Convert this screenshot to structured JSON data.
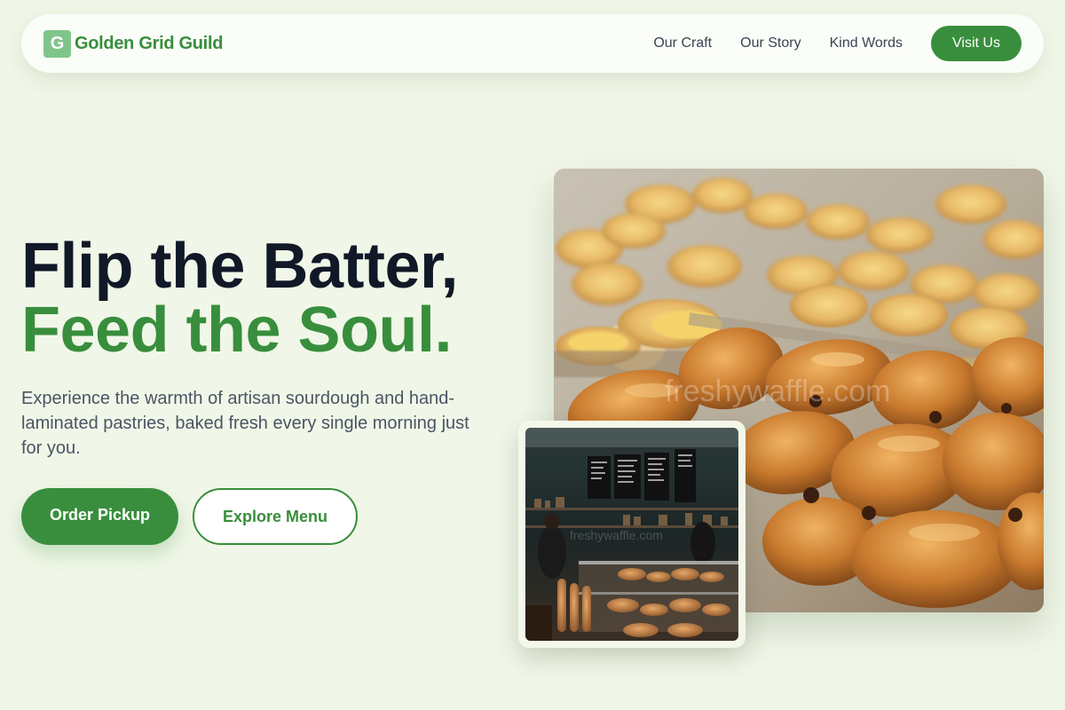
{
  "brand": {
    "logo_letter": "G",
    "name": "Golden Grid Guild"
  },
  "nav": {
    "links": [
      "Our Craft",
      "Our Story",
      "Kind Words"
    ],
    "cta": "Visit Us"
  },
  "hero": {
    "title_line1": "Flip the Batter,",
    "title_line2": "Feed the Soul.",
    "subtitle": "Experience the warmth of artisan sourdough and hand-laminated pastries, baked fresh every single morning just for you.",
    "primary_button": "Order Pickup",
    "secondary_button": "Explore Menu"
  },
  "images": {
    "main_alt": "tray-of-croissants-and-pastries-photo",
    "inset_alt": "bakery-shop-interior-photo"
  },
  "colors": {
    "background": "#f1f7e8",
    "accent": "#388e3c",
    "heading_dark": "#111827",
    "logo_mark": "#7fc58a"
  }
}
